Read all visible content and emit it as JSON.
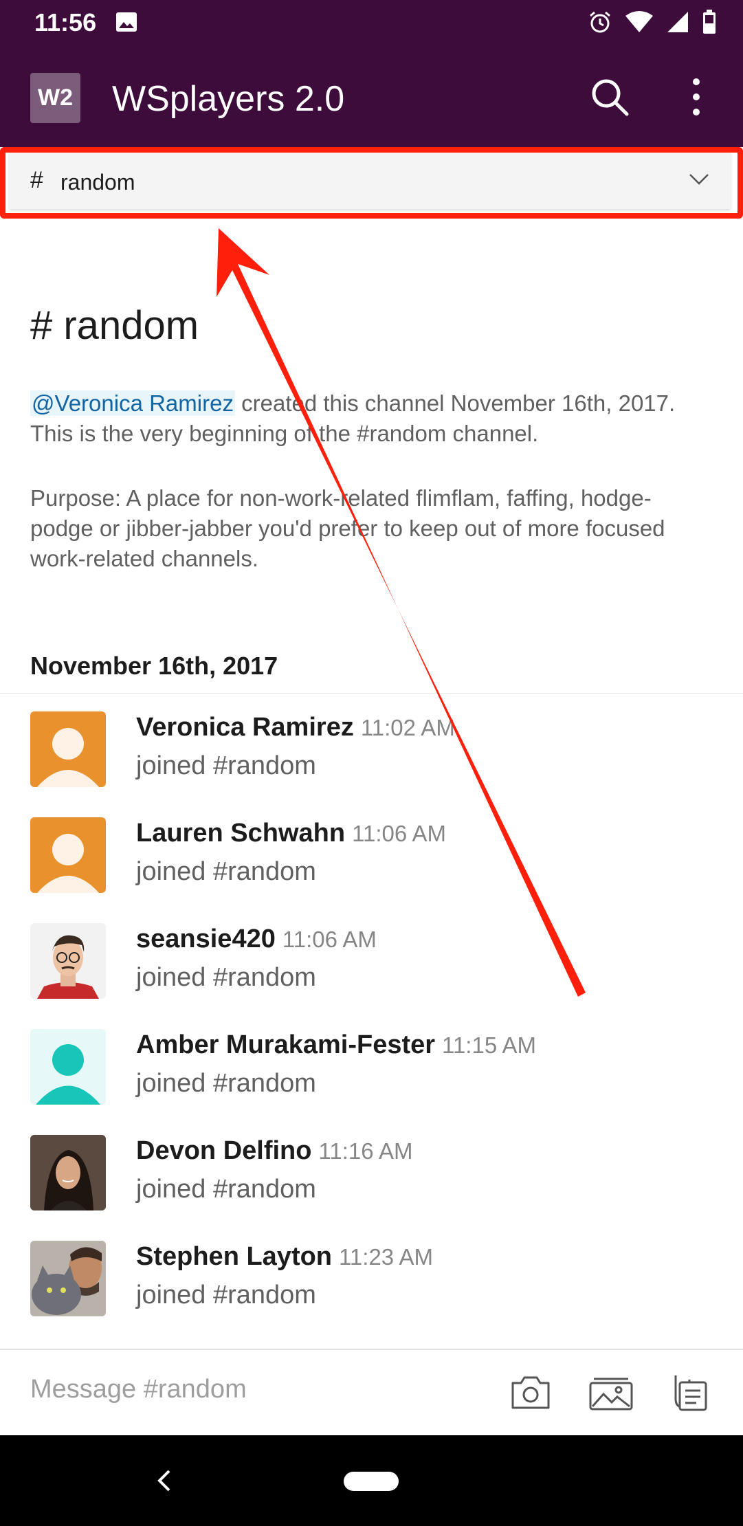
{
  "status_bar": {
    "time": "11:56"
  },
  "app_bar": {
    "workspace_initials": "W2",
    "workspace_name": "WSplayers 2.0"
  },
  "channel_selector": {
    "hash": "#",
    "name": "random"
  },
  "intro": {
    "title": "# random",
    "creator_mention": "@Veronica Ramirez",
    "created_text": " created this channel November 16th, 2017. This is the very beginning of the #random channel.",
    "purpose": "Purpose: A place for non-work-related flimflam, faffing, hodge-podge or jibber-jabber you'd prefer to keep out of more focused work-related channels."
  },
  "date_heading": "November 16th, 2017",
  "messages": [
    {
      "name": "Veronica Ramirez",
      "time": "11:02 AM",
      "body": "joined #random",
      "avatar": "default-orange"
    },
    {
      "name": "Lauren Schwahn",
      "time": "11:06 AM",
      "body": "joined #random",
      "avatar": "default-orange"
    },
    {
      "name": "seansie420",
      "time": "11:06 AM",
      "body": "joined #random",
      "avatar": "photo-man-glasses"
    },
    {
      "name": "Amber Murakami-Fester",
      "time": "11:15 AM",
      "body": "joined #random",
      "avatar": "default-teal"
    },
    {
      "name": "Devon Delfino",
      "time": "11:16 AM",
      "body": "joined #random",
      "avatar": "photo-woman"
    },
    {
      "name": "Stephen Layton",
      "time": "11:23 AM",
      "body": "joined #random",
      "avatar": "photo-man-cat"
    }
  ],
  "composer": {
    "placeholder": "Message #random"
  },
  "colors": {
    "app_bar": "#3d0c3b",
    "highlight": "#ff1f0a",
    "mention": "#1264a3"
  }
}
